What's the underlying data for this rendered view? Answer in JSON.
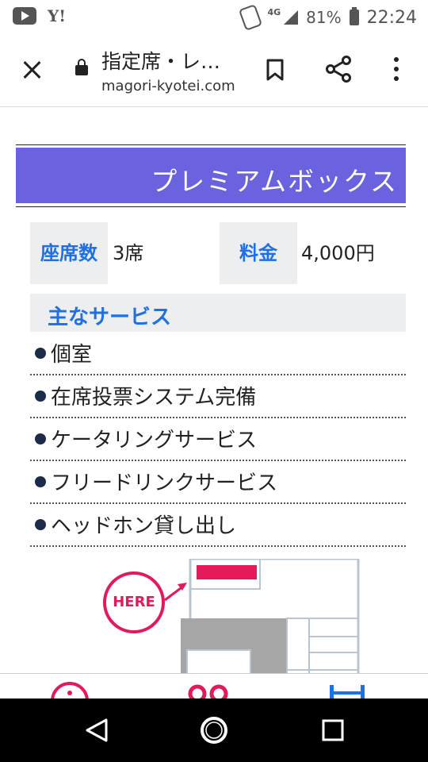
{
  "status_bar": {
    "network": "4G",
    "battery": "81%",
    "time": "22:24",
    "yahoo_label": "Y!"
  },
  "browser": {
    "title": "指定席・レ…",
    "url": "magori-kyotei.com"
  },
  "page": {
    "banner_title": "プレミアムボックス",
    "seats_label": "座席数",
    "seats_value": "3席",
    "price_label": "料金",
    "price_value": "4,000円",
    "services_title": "主なサービス",
    "services": [
      "個室",
      "在席投票システム完備",
      "ケータリングサービス",
      "フリードリンクサービス",
      "ヘッドホン貸し出し"
    ],
    "map_marker": "HERE"
  },
  "colors": {
    "banner_bg": "#6a62df",
    "label_blue": "#1e70e6",
    "accent_pink": "#e3195a"
  },
  "icons": [
    "youtube-icon",
    "yahoo-icon",
    "nfc-icon",
    "signal-icon",
    "battery-icon",
    "close-icon",
    "lock-icon",
    "bookmark-icon",
    "share-icon",
    "more-vert-icon",
    "info-icon",
    "glasses-icon",
    "seat-icon",
    "back-icon",
    "home-icon",
    "recents-icon"
  ]
}
